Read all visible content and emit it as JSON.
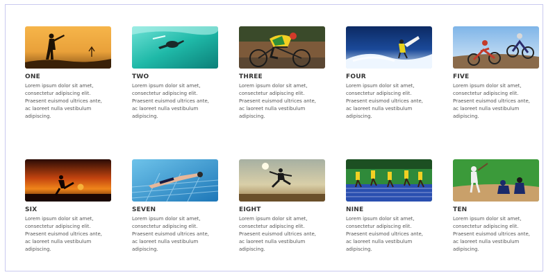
{
  "cards": [
    {
      "title": "ONE",
      "image": "sunset-batter-silhouette-photo"
    },
    {
      "title": "TWO",
      "image": "underwater-surfer-photo"
    },
    {
      "title": "THREE",
      "image": "cyclist-race-photo"
    },
    {
      "title": "FOUR",
      "image": "wave-surfer-photo"
    },
    {
      "title": "FIVE",
      "image": "motocross-riders-photo"
    },
    {
      "title": "SIX",
      "image": "sunset-soccer-kick-photo"
    },
    {
      "title": "SEVEN",
      "image": "pool-swimmer-photo"
    },
    {
      "title": "EIGHT",
      "image": "martial-arts-jump-photo"
    },
    {
      "title": "NINE",
      "image": "track-sprinters-photo"
    },
    {
      "title": "TEN",
      "image": "baseball-batter-photo"
    }
  ],
  "description_lines": [
    "Lorem ipsum dolor sit amet,",
    "consectetur adipiscing elit.",
    "Praesent euismod ultrices ante,",
    "ac laoreet nulla vestibulum",
    "adipiscing."
  ]
}
